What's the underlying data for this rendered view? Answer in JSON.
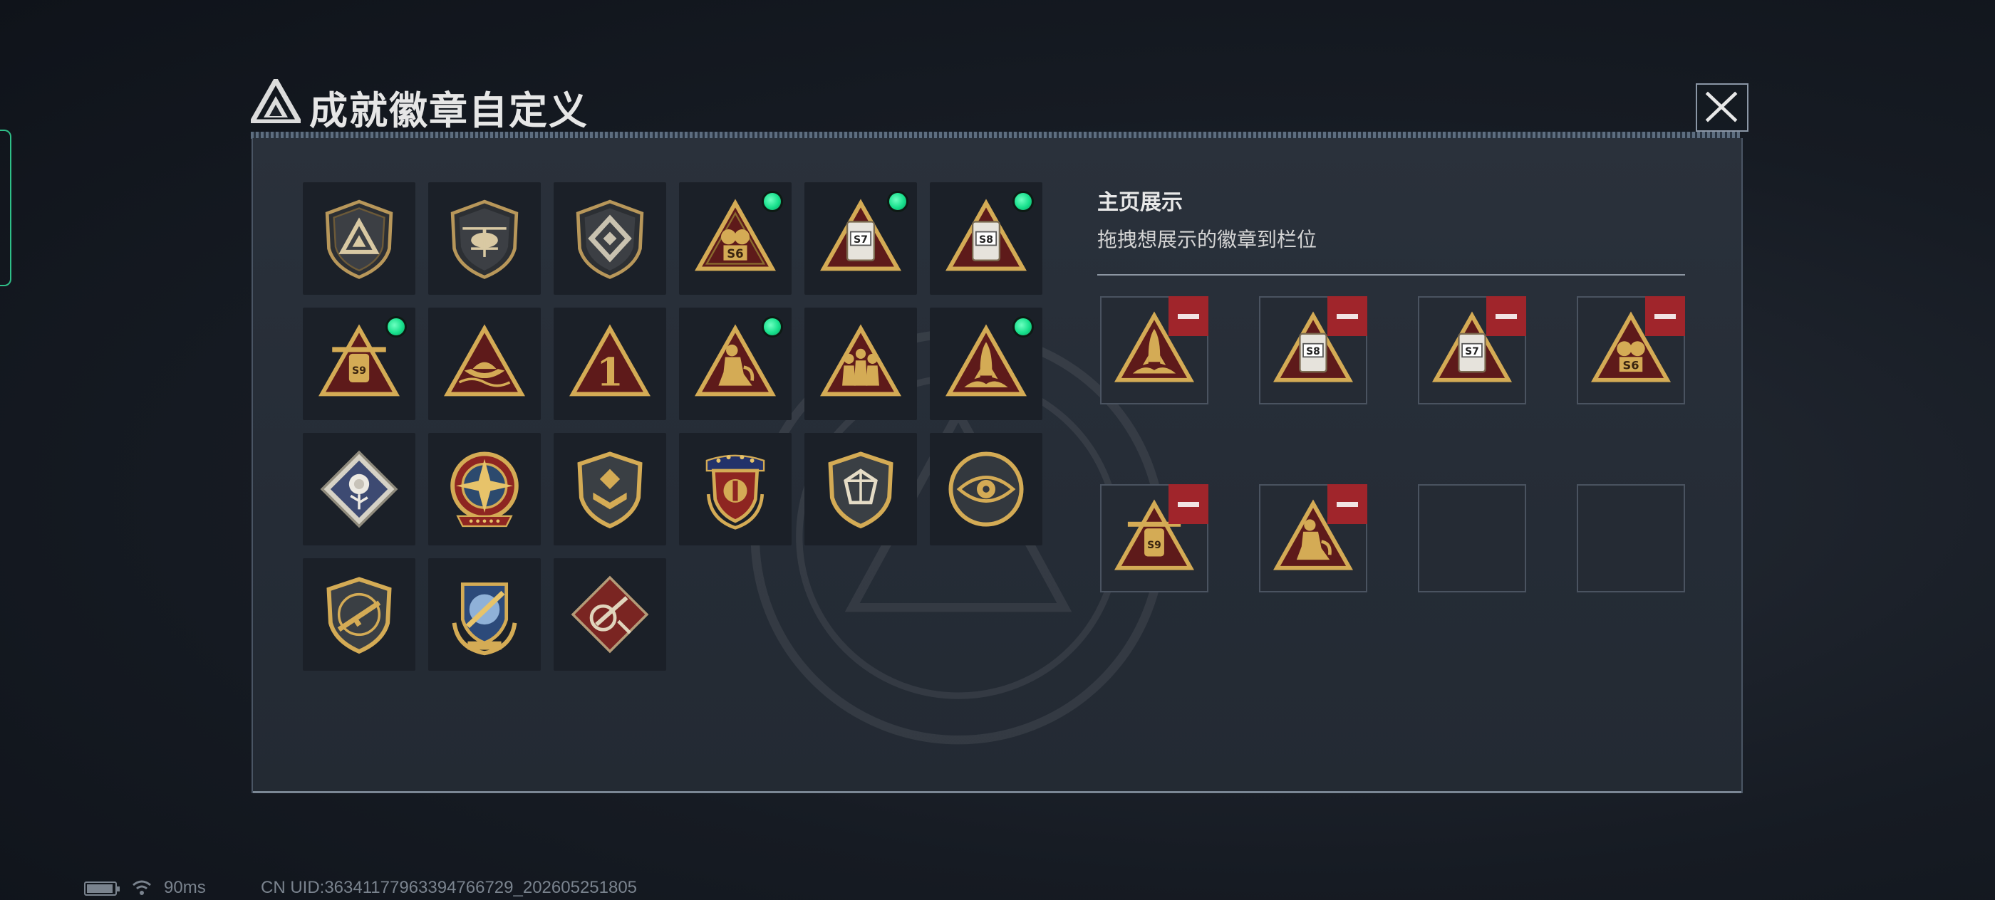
{
  "window": {
    "title": "成就徽章自定义",
    "close_icon": "close-icon"
  },
  "badge_collection": [
    {
      "icon": "delta-shield-badge",
      "equipped": false
    },
    {
      "icon": "helicopter-shield-badge",
      "equipped": false
    },
    {
      "icon": "diamond-emblem-shield-badge",
      "equipped": false
    },
    {
      "icon": "season-s6-triangle-badge",
      "label": "S6",
      "equipped": true
    },
    {
      "icon": "season-s7-triangle-badge",
      "label": "S7",
      "equipped": true
    },
    {
      "icon": "season-s8-triangle-badge",
      "label": "S8",
      "equipped": true
    },
    {
      "icon": "season-s9-triangle-badge",
      "label": "S9",
      "equipped": true
    },
    {
      "icon": "boat-triangle-badge",
      "equipped": false
    },
    {
      "icon": "number-one-triangle-badge",
      "label": "1",
      "equipped": false
    },
    {
      "icon": "kneeling-soldier-triangle-badge",
      "equipped": true
    },
    {
      "icon": "squad-triangle-badge",
      "equipped": false
    },
    {
      "icon": "rocket-triangle-badge",
      "equipped": true
    },
    {
      "icon": "rose-diamond-badge",
      "equipped": false
    },
    {
      "icon": "star-compass-medal-badge",
      "equipped": false
    },
    {
      "icon": "chevron-shield-badge",
      "equipped": false
    },
    {
      "icon": "stars-laurel-shield-badge",
      "equipped": false
    },
    {
      "icon": "gem-shield-badge",
      "equipped": false
    },
    {
      "icon": "eye-circle-badge",
      "equipped": false
    },
    {
      "icon": "rifle-shield-badge",
      "equipped": false
    },
    {
      "icon": "missile-crest-badge",
      "equipped": false
    },
    {
      "icon": "red-diamond-weapon-badge",
      "equipped": false
    }
  ],
  "showcase": {
    "title": "主页展示",
    "subtitle": "拖拽想展示的徽章到栏位",
    "slots": [
      {
        "icon": "rocket-triangle-badge",
        "filled": true
      },
      {
        "icon": "season-s8-triangle-badge",
        "label": "S8",
        "filled": true
      },
      {
        "icon": "season-s7-triangle-badge",
        "label": "S7",
        "filled": true
      },
      {
        "icon": "season-s6-triangle-badge",
        "label": "S6",
        "filled": true
      },
      {
        "icon": "season-s9-triangle-badge",
        "label": "S9",
        "filled": true
      },
      {
        "icon": "kneeling-soldier-triangle-badge",
        "filled": true
      },
      {
        "filled": false
      },
      {
        "filled": false
      }
    ],
    "remove_icon": "minus-icon"
  },
  "status_bar": {
    "battery_icon": "battery-icon",
    "wifi_icon": "wifi-icon",
    "ping": "90ms",
    "uid": "CN UID:36341177963394766729_202605251805"
  },
  "colors": {
    "gold": "#c9a24a",
    "dark_red": "#6b1e1c",
    "equipped_green": "#17e08c",
    "remove_red": "#a0252b"
  }
}
